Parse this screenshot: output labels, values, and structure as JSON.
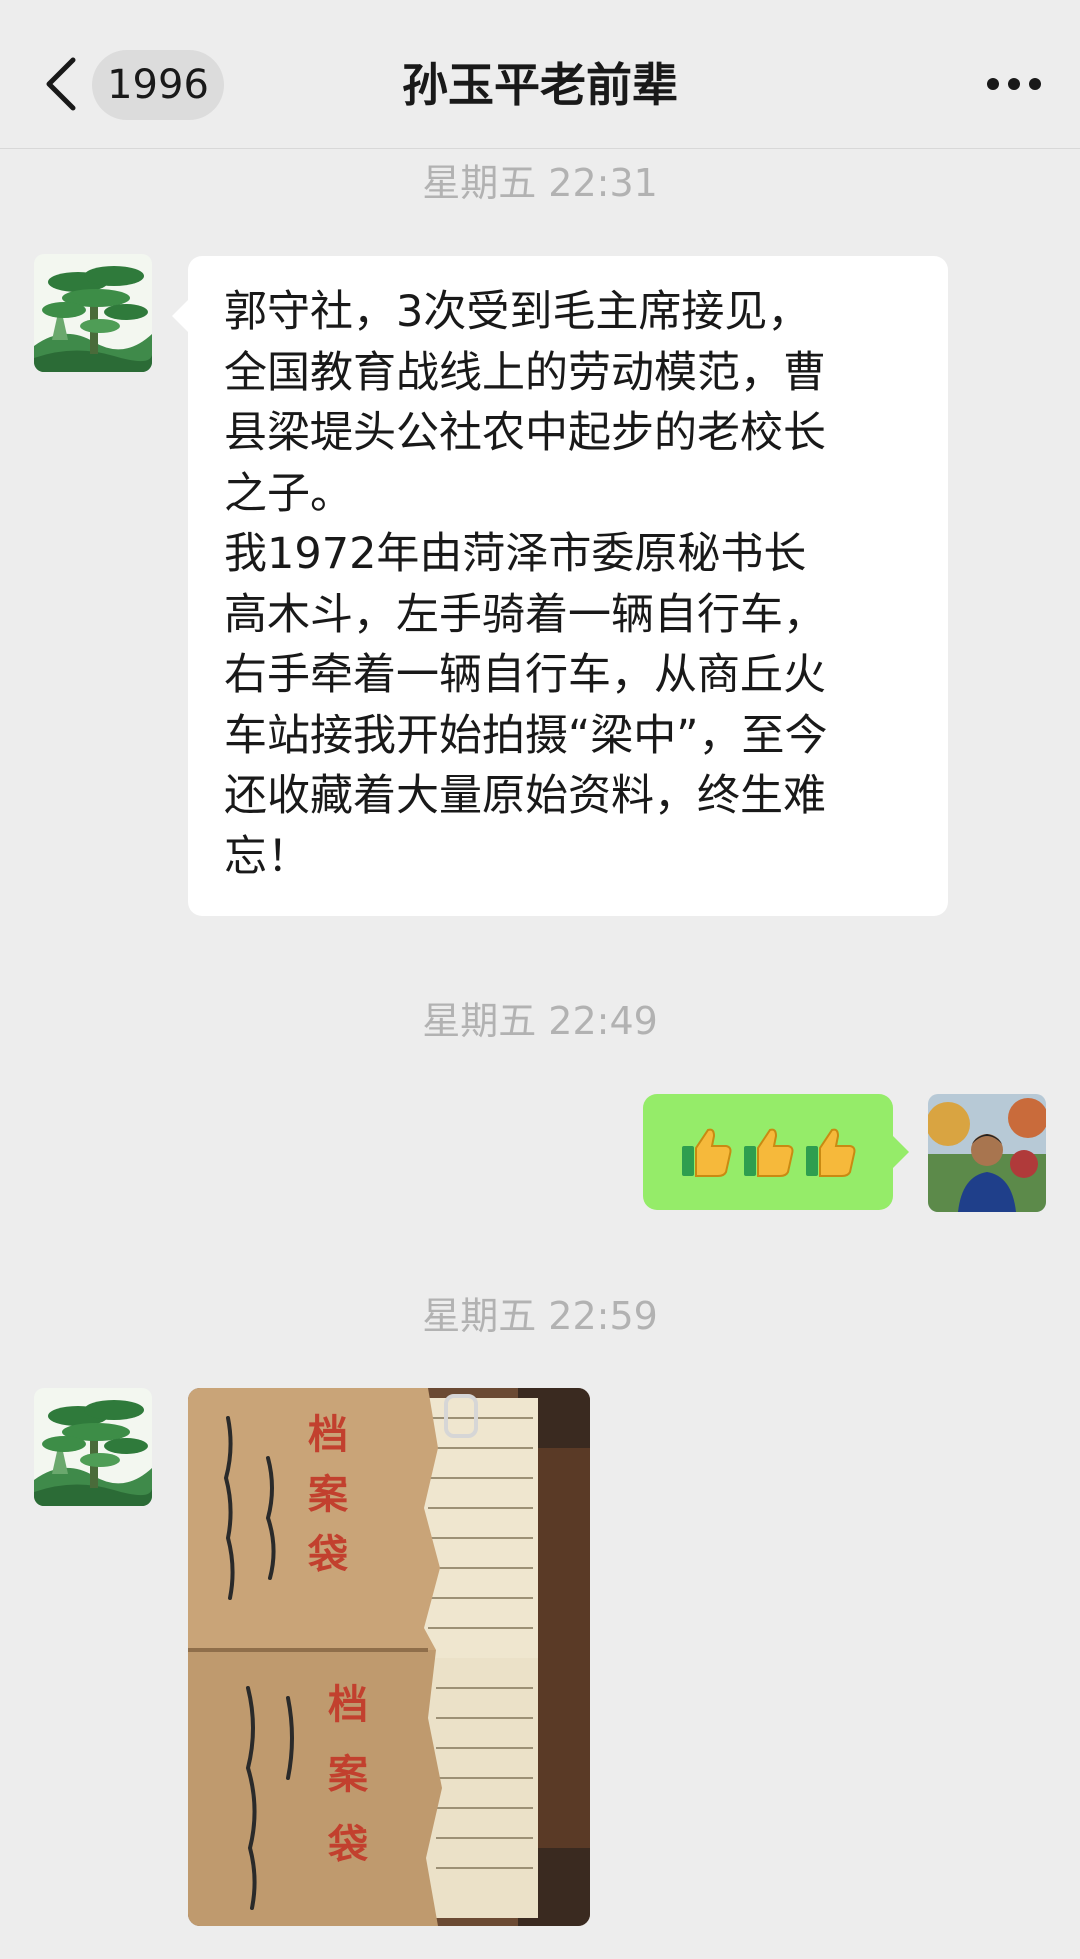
{
  "header": {
    "unread_count": "1996",
    "title": "孙玉平老前辈"
  },
  "messages": [
    {
      "timestamp": "星期五 22:31",
      "sender": "contact",
      "text": "郭守社，3次受到毛主席接见，\n全国教育战线上的劳动模范，曹\n县梁堤头公社农中起步的老校长\n之子。\n我1972年由菏泽市委原秘书长\n高木斗，左手骑着一辆自行车，\n右手牵着一辆自行车，从商丘火\n车站接我开始拍摄“梁中”，至今\n还收藏着大量原始资料，终生难\n忘！"
    },
    {
      "timestamp": "星期五 22:49",
      "sender": "me",
      "emoji": "👍👍👍"
    },
    {
      "timestamp": "星期五 22:59",
      "sender": "contact",
      "image_description": "archive-folders-photo",
      "image_texts": [
        "档案袋",
        "档案袋"
      ]
    }
  ],
  "colors": {
    "background": "#ededed",
    "incoming_bubble": "#ffffff",
    "outgoing_bubble": "#95ec69",
    "timestamp": "#b2b2b2"
  }
}
